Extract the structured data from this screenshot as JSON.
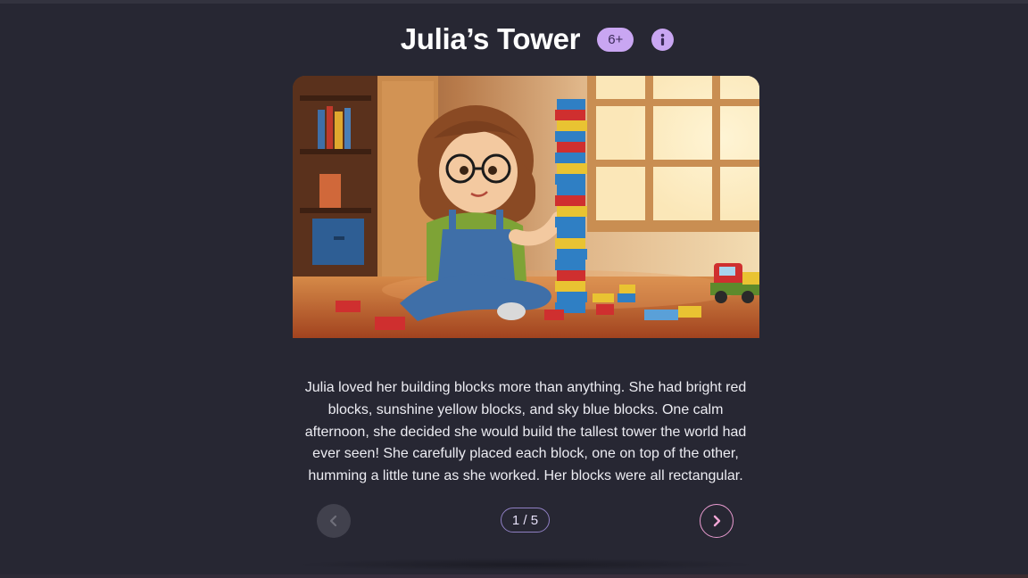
{
  "story": {
    "title": "Julia’s Tower",
    "age_badge": "6+",
    "text": "Julia loved her building blocks more than anything. She had bright red blocks, sunshine yellow blocks, and sky blue blocks. One calm afternoon, she decided she would build the tallest tower the world had ever seen! She carefully placed each block, one on top of the other, humming a little tune as she worked. Her blocks were all rectangular."
  },
  "pagination": {
    "counter": "1 / 5",
    "current": 1,
    "total": 5
  },
  "icons": {
    "info": "info-icon",
    "prev": "chevron-left-icon",
    "next": "chevron-right-icon"
  },
  "colors": {
    "background": "#272733",
    "accent": "#c9a6f2",
    "next_accent": "#e99bd0"
  }
}
